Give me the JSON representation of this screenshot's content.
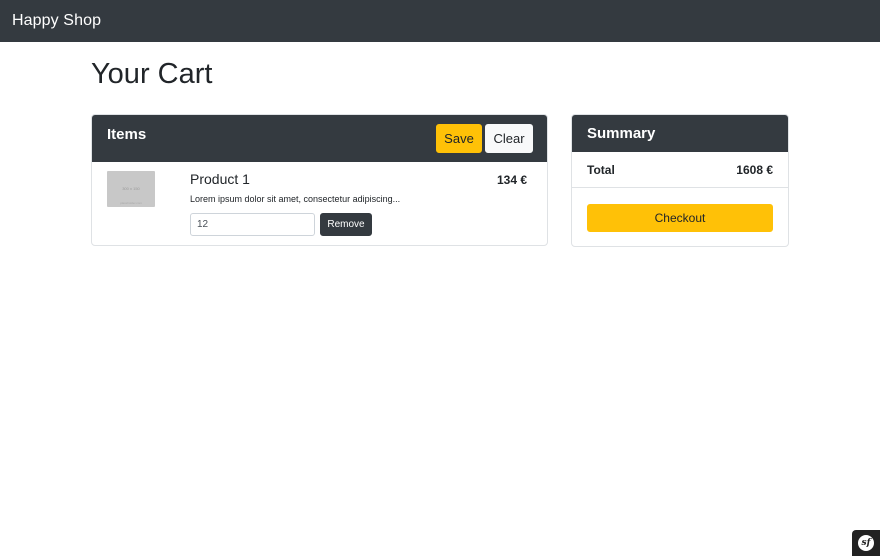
{
  "navbar": {
    "brand": "Happy Shop"
  },
  "page": {
    "title": "Your Cart"
  },
  "cart": {
    "header": "Items",
    "save_label": "Save",
    "clear_label": "Clear",
    "items": [
      {
        "name": "Product 1",
        "description": "Lorem ipsum dolor sit amet, consectetur adipiscing...",
        "price": "134 €",
        "quantity": "12",
        "remove_label": "Remove",
        "thumbnail_text": "300 x 150",
        "thumbnail_subtext": "placeholder.com"
      }
    ]
  },
  "summary": {
    "header": "Summary",
    "total_label": "Total",
    "total_value": "1608 €",
    "checkout_label": "Checkout"
  },
  "debug_toolbar": {
    "logo_text": "sf",
    "icon": "symfony-logo-icon"
  },
  "colors": {
    "navbar_bg": "#343a40",
    "accent": "#ffc107",
    "dark_button": "#343a40",
    "light_button": "#f8f9fa"
  }
}
